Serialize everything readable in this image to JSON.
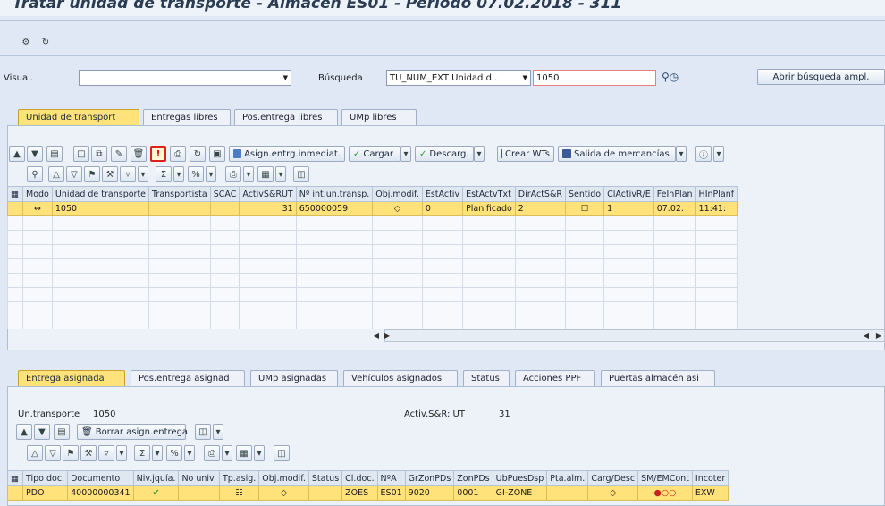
{
  "window": {
    "title": "Tratar unidad de transporte - Almacen ES01 - Periodo 07.02.2018 - 311"
  },
  "selection": {
    "visual_label": "Visual.",
    "visual_value": "",
    "busqueda_label": "Búsqueda",
    "busqueda_value": "TU_NUM_EXT Unidad d..",
    "busqueda_input": "1050",
    "open_search_button": "Abrir búsqueda ampl."
  },
  "top_tabs": [
    {
      "label": "Unidad de transport",
      "active": true
    },
    {
      "label": "Entregas libres",
      "active": false
    },
    {
      "label": "Pos.entrega libres",
      "active": false
    },
    {
      "label": "UMp libres",
      "active": false
    }
  ],
  "toolbar": {
    "assign_immediate": "Asign.entrg.inmediat.",
    "load": "Cargar",
    "unload": "Descarg.",
    "create_wts": "Crear WTs",
    "goods_issue": "Salida de mercancías"
  },
  "upper_table": {
    "columns": [
      "Modo",
      "Unidad de transporte",
      "Transportista",
      "SCAC",
      "ActivS&RUT",
      "Nº int.un.transp.",
      "Obj.modif.",
      "EstActiv",
      "EstActvTxt",
      "DirActS&R",
      "Sentido",
      "ClActivR/E",
      "FeInPlan",
      "HInPlanf"
    ],
    "rows": [
      {
        "modo": "↔",
        "unidad": "1050",
        "transportista": "",
        "scac": "",
        "activ": "31",
        "nint": "650000059",
        "objmod": "◇",
        "estactiv": "0",
        "estactvtxt": "Planificado",
        "diract": "2",
        "sentido": "☐",
        "clactiv": "1",
        "feinplan": "07.02.",
        "hinplan": "11:41:"
      }
    ]
  },
  "bottom_tabs": [
    {
      "label": "Entrega asignada",
      "active": true
    },
    {
      "label": "Pos.entrega asignad",
      "active": false
    },
    {
      "label": "UMp asignadas",
      "active": false
    },
    {
      "label": "Vehículos asignados",
      "active": false
    },
    {
      "label": "Status",
      "active": false
    },
    {
      "label": "Acciones PPF",
      "active": false
    },
    {
      "label": "Puertas almacén asi",
      "active": false
    }
  ],
  "bottom_info": {
    "ut_label": "Un.transporte",
    "ut_value": "1050",
    "activ_label": "Activ.S&R: UT",
    "activ_value": "31",
    "delete_assign_button": "Borrar asign.entrega"
  },
  "lower_table": {
    "columns": [
      "Tipo doc.",
      "Documento",
      "Niv.jquía.",
      "No univ.",
      "Tp.asig.",
      "Obj.modif.",
      "Status",
      "Cl.doc.",
      "NºA",
      "GrZonPDs",
      "ZonPDs",
      "UbPuesDsp",
      "Pta.alm.",
      "Carg/Desc",
      "SM/EMCont",
      "Incoter"
    ],
    "rows": [
      {
        "tipo": "PDO",
        "doc": "40000000341",
        "niv": "✔",
        "nouniv": "",
        "tpasig": "☷",
        "objmod": "◇",
        "status": "",
        "cldoc": "ZOES",
        "na": "ES01",
        "grzon": "9020",
        "zon": "0001",
        "ubpues": "GI-ZONE",
        "pta": "",
        "carg": "◇",
        "smem": "●○○",
        "incoter": "EXW"
      }
    ]
  },
  "colors": {
    "highlight": "#ffe27a",
    "red_frame": "#e0201c"
  }
}
